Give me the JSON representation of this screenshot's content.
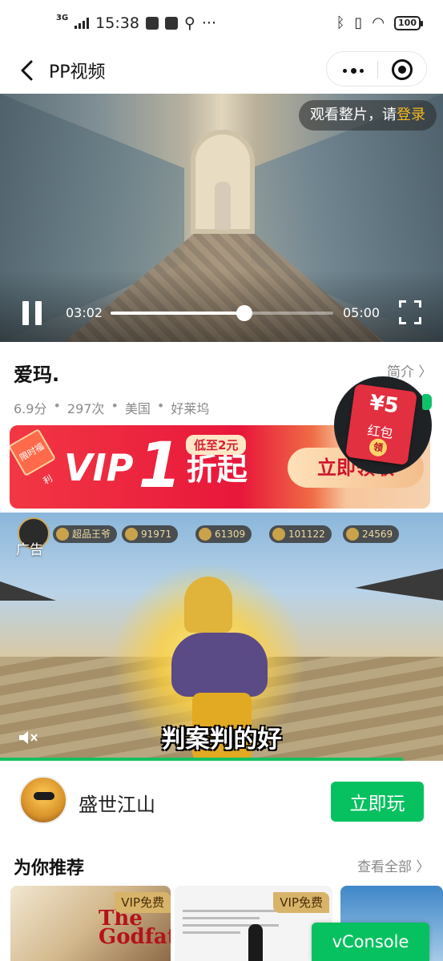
{
  "status_bar": {
    "network": "3G",
    "time": "15:38",
    "extra": "···",
    "battery": "100"
  },
  "nav": {
    "title": "PP视频"
  },
  "player": {
    "login_prompt": "观看整片，请",
    "login_link": "登录",
    "current_time": "03:02",
    "total_time": "05:00",
    "progress": 0.6
  },
  "video_info": {
    "title": "爱玛.",
    "intro_label": "简介 〉",
    "score": "6.9分",
    "plays": "297次",
    "region": "美国",
    "source": "好莱坞",
    "separator": "•"
  },
  "vip_banner": {
    "tag": "限时福利",
    "vip_text": "VIP",
    "number": "1",
    "discount_text": "折起",
    "lowest": "低至2元",
    "claim_label": "立即领取"
  },
  "red_packet": {
    "amount": "¥5",
    "label": "红包",
    "action": "领"
  },
  "ad": {
    "label": "广告",
    "game_title": "超品王爷",
    "hud_values": [
      "91971",
      "61309",
      "101122",
      "24569"
    ],
    "subtitle": "判案判的好",
    "progress": 0.91,
    "app_name": "盛世江山",
    "play_label": "立即玩"
  },
  "recommend": {
    "title": "为你推荐",
    "view_all": "查看全部 〉",
    "cards": [
      {
        "badge": "VIP免费",
        "poster_text": "The Godfather"
      },
      {
        "badge": "VIP免费"
      }
    ]
  },
  "vconsole": {
    "label": "vConsole"
  },
  "colors": {
    "accent_green": "#07c160",
    "login_gold": "#f5b81e",
    "vip_red": "#e8173a"
  }
}
